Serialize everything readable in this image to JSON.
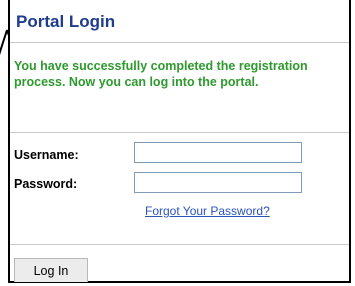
{
  "header": {
    "title": "Portal Login"
  },
  "message": "You have successfully completed the registration process. Now you can log into the portal.",
  "form": {
    "username_label": "Username:",
    "username_value": "",
    "password_label": "Password:",
    "password_value": "",
    "forgot_link": "Forgot Your Password?"
  },
  "actions": {
    "login_label": "Log In"
  },
  "colors": {
    "title": "#1f3d8f",
    "message": "#2e9a2e",
    "link": "#2b54b8"
  },
  "icons": {
    "edge_mark": "arrow-fragment-icon"
  }
}
